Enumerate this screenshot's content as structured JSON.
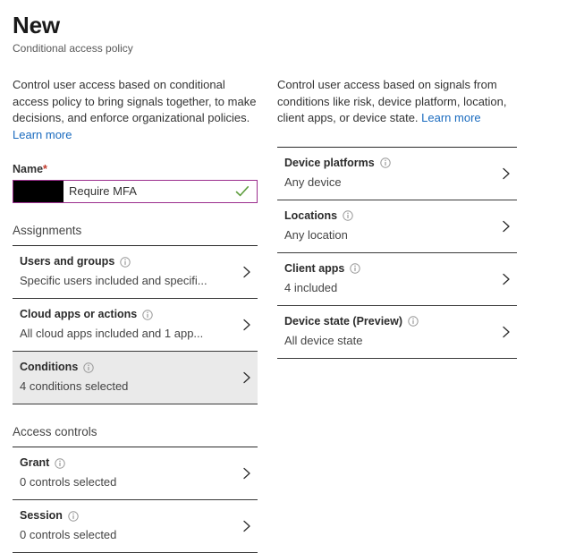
{
  "header": {
    "title": "New",
    "subtitle": "Conditional access policy"
  },
  "left": {
    "intro_text": "Control user access based on conditional access policy to bring signals together, to make decisions, and enforce organizational policies. ",
    "intro_link": "Learn more",
    "name_field": {
      "label": "Name",
      "required_marker": "*",
      "value": "Require MFA",
      "redacted": true,
      "valid_icon": "check-icon",
      "border_color": "#9b2e8e",
      "check_color": "#5f9e3f"
    },
    "sections": [
      {
        "title": "Assignments",
        "rows": [
          {
            "title": "Users and groups",
            "subtitle": "Specific users included and specifi...",
            "info_icon": "info-icon",
            "chevron_icon": "chevron-right-icon",
            "selected": false
          },
          {
            "title": "Cloud apps or actions",
            "subtitle": "All cloud apps included and 1 app...",
            "info_icon": "info-icon",
            "chevron_icon": "chevron-right-icon",
            "selected": false
          },
          {
            "title": "Conditions",
            "subtitle": "4 conditions selected",
            "info_icon": "info-icon",
            "chevron_icon": "chevron-right-icon",
            "selected": true
          }
        ]
      },
      {
        "title": "Access controls",
        "rows": [
          {
            "title": "Grant",
            "subtitle": "0 controls selected",
            "info_icon": "info-icon",
            "chevron_icon": "chevron-right-icon",
            "selected": false
          },
          {
            "title": "Session",
            "subtitle": "0 controls selected",
            "info_icon": "info-icon",
            "chevron_icon": "chevron-right-icon",
            "selected": false
          }
        ]
      }
    ]
  },
  "right": {
    "intro_text": "Control user access based on signals from conditions like risk, device platform, location, client apps, or device state. ",
    "intro_link": "Learn more",
    "rows": [
      {
        "title": "Device platforms",
        "subtitle": "Any device",
        "info_icon": "info-icon",
        "chevron_icon": "chevron-right-icon"
      },
      {
        "title": "Locations",
        "subtitle": "Any location",
        "info_icon": "info-icon",
        "chevron_icon": "chevron-right-icon"
      },
      {
        "title": "Client apps",
        "subtitle": "4 included",
        "info_icon": "info-icon",
        "chevron_icon": "chevron-right-icon"
      },
      {
        "title": "Device state (Preview)",
        "subtitle": "All device state",
        "info_icon": "info-icon",
        "chevron_icon": "chevron-right-icon"
      }
    ]
  },
  "colors": {
    "link": "#1a6bbf",
    "accent_border": "#9b2e8e",
    "valid_check": "#5f9e3f",
    "selected_row_bg": "#eaeaea",
    "required_star": "#c0392b"
  }
}
